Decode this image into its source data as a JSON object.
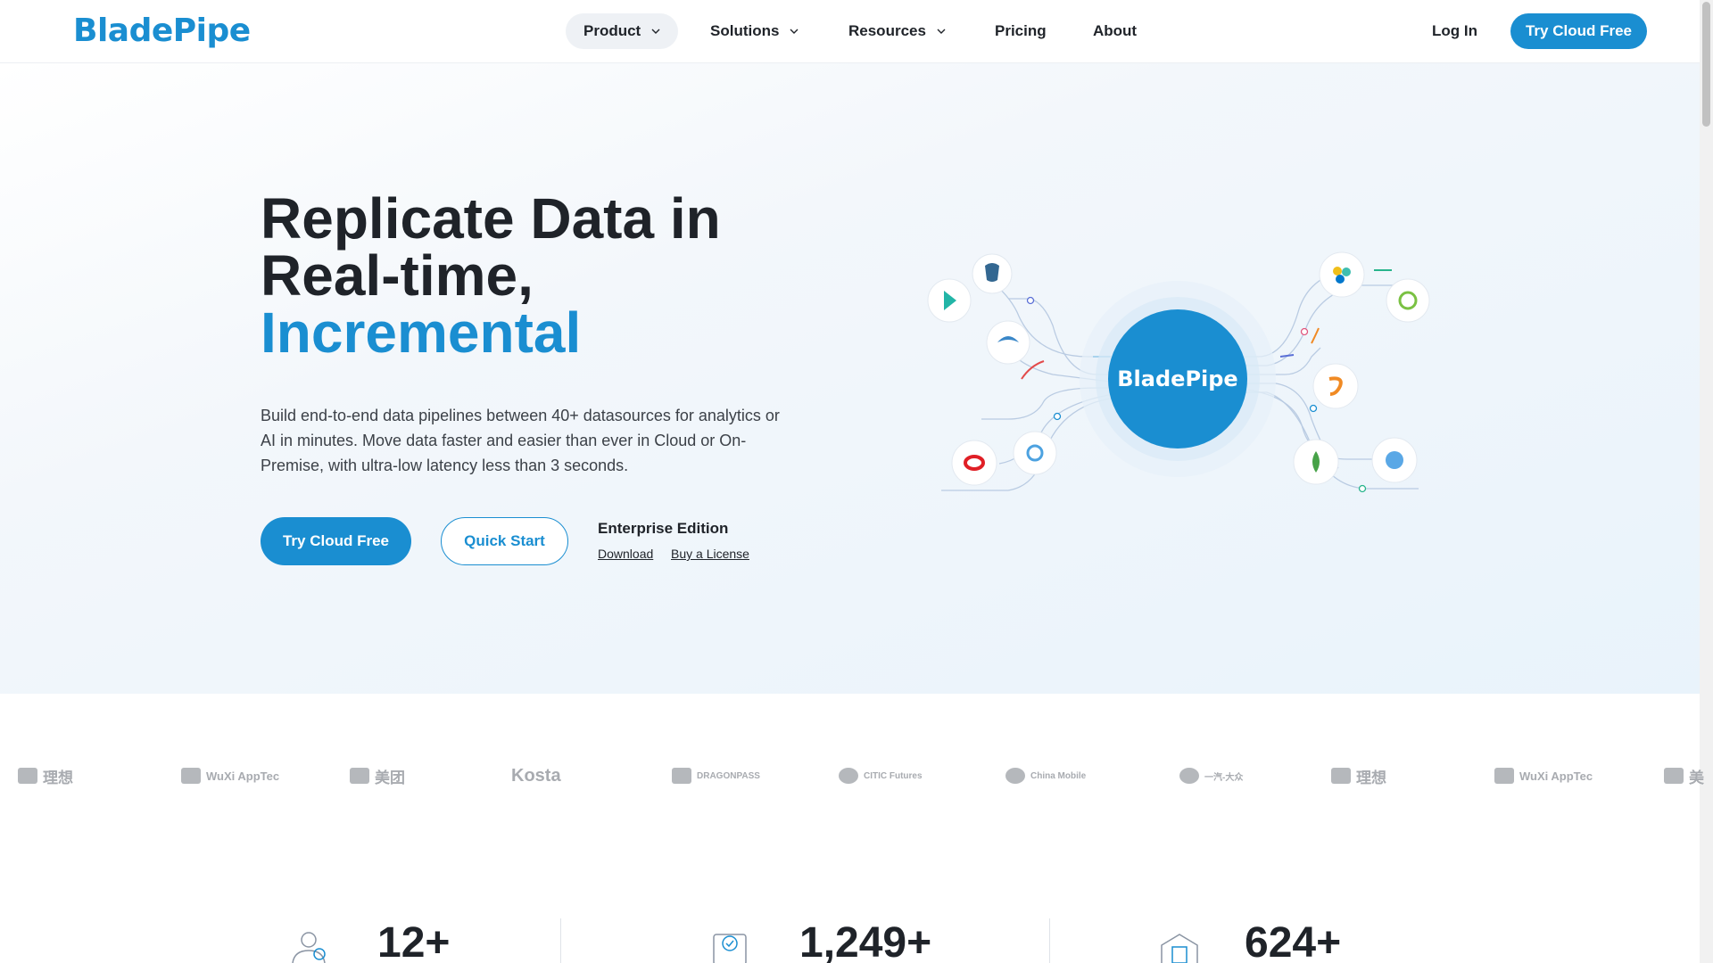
{
  "brand": {
    "logo_text": "BladePipe",
    "accent_color": "#1a8ed1"
  },
  "nav": {
    "items": [
      {
        "label": "Product",
        "has_dropdown": true,
        "active": true
      },
      {
        "label": "Solutions",
        "has_dropdown": true
      },
      {
        "label": "Resources",
        "has_dropdown": true
      },
      {
        "label": "Pricing"
      },
      {
        "label": "About"
      }
    ],
    "login": "Log In",
    "cta": "Try Cloud Free"
  },
  "hero": {
    "title_line1": "Replicate Data in",
    "title_line2": "Real-time,",
    "title_accent": "Incremental",
    "description": "Build end-to-end data pipelines between 40+ datasources for analytics or AI in minutes. Move data faster and easier than ever in Cloud or On-Premise, with ultra-low latency less than 3 seconds.",
    "primary_cta": "Try Cloud Free",
    "secondary_cta": "Quick Start",
    "enterprise_title": "Enterprise Edition",
    "download_link": "Download",
    "license_link": "Buy a License",
    "diagram_center_label": "BladePipe"
  },
  "customer_logos": [
    {
      "name": "理想",
      "icon": "lixiang-logo"
    },
    {
      "name": "WuXi AppTec",
      "icon": "wuxi-logo"
    },
    {
      "name": "美团",
      "icon": "meituan-logo"
    },
    {
      "name": "Kosta",
      "icon": "kosta-logo"
    },
    {
      "name": "DRAGONPASS",
      "icon": "dragonpass-logo"
    },
    {
      "name": "CITIC Futures",
      "icon": "citic-logo"
    },
    {
      "name": "China Mobile",
      "icon": "chinamobile-logo"
    },
    {
      "name": "一汽-大众",
      "icon": "faw-vw-logo"
    },
    {
      "name": "理想",
      "icon": "lixiang-logo"
    },
    {
      "name": "WuXi AppTec",
      "icon": "wuxi-logo"
    },
    {
      "name": "美",
      "icon": "meituan-logo"
    }
  ],
  "stats": [
    {
      "value": "12+",
      "icon": "cost-saving-icon"
    },
    {
      "value": "1,249+",
      "icon": "clipboard-check-icon"
    },
    {
      "value": "624+",
      "icon": "network-building-icon"
    }
  ]
}
